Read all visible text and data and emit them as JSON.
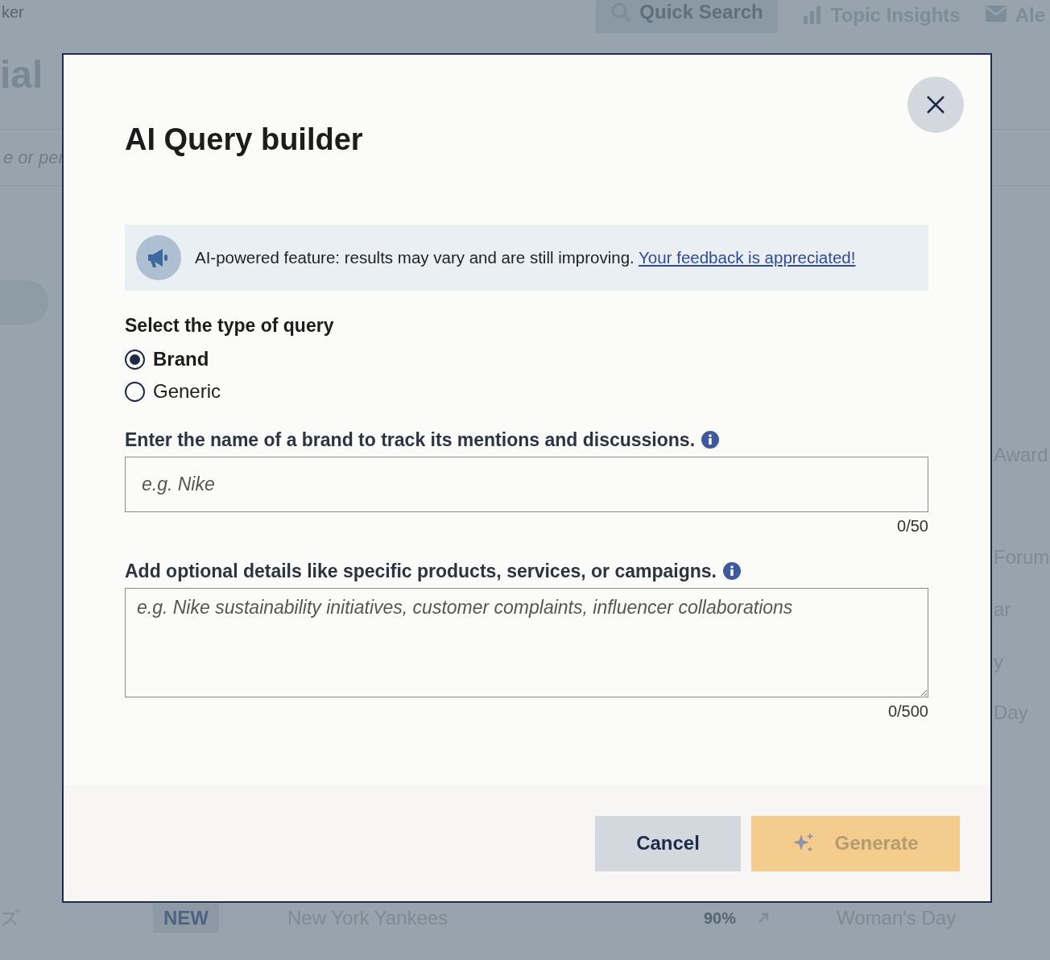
{
  "background": {
    "nav": {
      "brand_fragment": "ker",
      "items": [
        {
          "kind": "search",
          "label": "Quick Search",
          "selected": true
        },
        {
          "kind": "chart",
          "label": "Topic Insights",
          "selected": false
        },
        {
          "kind": "mail",
          "label": "Ale",
          "selected": false
        }
      ]
    },
    "heading_fragment": "ial",
    "search_fragment": "e or per",
    "side_items": [
      "Award",
      "Forum",
      "ar",
      "y",
      "Day"
    ],
    "row": {
      "cell_1": "ズ",
      "badge": "NEW",
      "name": "New York Yankees",
      "percent": "90%",
      "source": "Woman's Day"
    }
  },
  "dialog": {
    "title": "AI Query builder",
    "notice": {
      "text": "AI-powered feature: results may vary and are still improving.",
      "link": "Your feedback is appreciated!"
    },
    "query_type": {
      "label": "Select the type of query",
      "options": [
        {
          "label": "Brand",
          "selected": true
        },
        {
          "label": "Generic",
          "selected": false
        }
      ]
    },
    "fields": [
      {
        "kind": "input",
        "label": "Enter the name of a brand to track its mentions and discussions.",
        "placeholder": "e.g. Nike",
        "counter": "0/50"
      },
      {
        "kind": "textarea",
        "label": "Add optional details like specific products, services, or campaigns.",
        "placeholder": "e.g. Nike sustainability initiatives, customer complaints, influencer collaborations",
        "counter": "0/500"
      }
    ],
    "buttons": [
      {
        "kind": "secondary",
        "label": "Cancel",
        "disabled": false
      },
      {
        "kind": "primary",
        "label": "Generate",
        "disabled": true
      }
    ]
  }
}
